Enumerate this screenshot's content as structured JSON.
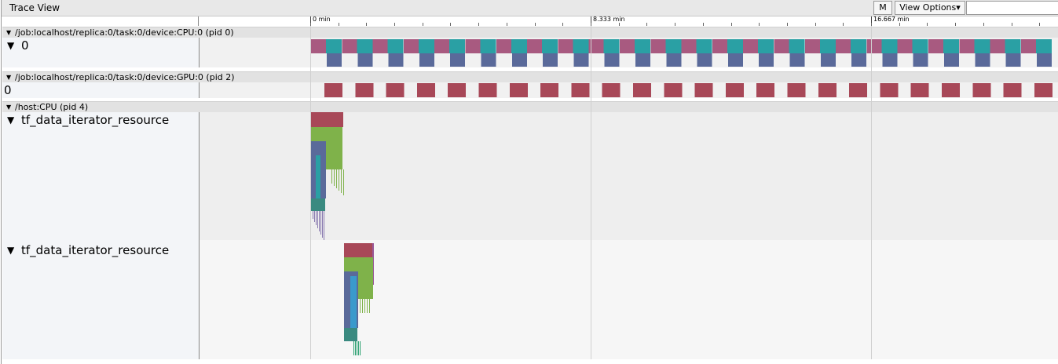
{
  "window": {
    "title": "Trace View"
  },
  "toolbar": {
    "m_label": "M",
    "view_options_label": "View Options",
    "chevron": "▾",
    "search_value": ""
  },
  "ruler": {
    "ticks": [
      "0 min",
      "8.333 min",
      "16.667 min"
    ]
  },
  "processes": [
    {
      "label": "/job:localhost/replica:0/task:0/device:CPU:0 (pid 0)",
      "threads": [
        {
          "label": "0",
          "expanded": true
        }
      ]
    },
    {
      "label": "/job:localhost/replica:0/task:0/device:GPU:0 (pid 2)",
      "threads": [
        {
          "label": "0",
          "expanded": false
        }
      ]
    },
    {
      "label": "/host:CPU (pid 4)",
      "threads": [
        {
          "label": "tf_data_iterator_resource",
          "expanded": true
        },
        {
          "label": "tf_data_iterator_resource",
          "expanded": true
        }
      ]
    }
  ],
  "icons": {
    "expand": "triangle-down-icon"
  },
  "colors": {
    "teal": "#2aa0a4",
    "mauve": "#a85a80",
    "slate": "#5a6a9a",
    "brick": "#a84858",
    "olive": "#7fb24a"
  }
}
